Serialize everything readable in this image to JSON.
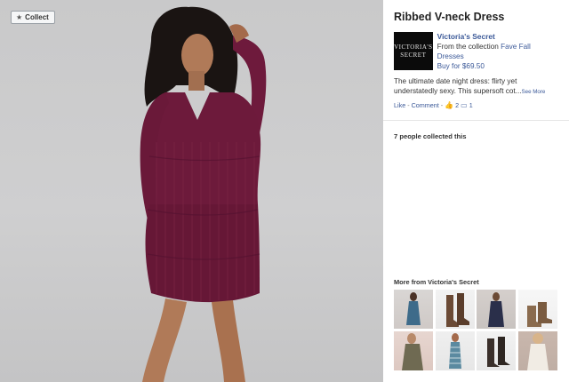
{
  "stage": {
    "collect_label": "Collect",
    "photo_icon": "model-in-dress-photo"
  },
  "panel": {
    "title": "Ribbed V-neck Dress",
    "brand": {
      "logo_lines": [
        "VICTORIA'S",
        "SECRET"
      ],
      "name": "Victoria's Secret",
      "collection_prefix": "From the collection ",
      "collection_name": "Fave Fall Dresses",
      "buy_label": "Buy for $69.50"
    },
    "description": "The ultimate date night dress: flirty yet understatedly sexy. This supersoft cot...",
    "see_more": "See More",
    "actions": {
      "like": "Like",
      "dash": " - ",
      "comment": "Comment",
      "dash2": " - ",
      "like_count": "2",
      "comment_count": "1"
    },
    "collected_text": "7 people collected this",
    "more_title": "More from Victoria's Secret",
    "thumbnails": [
      {
        "label": "blue-dress"
      },
      {
        "label": "brown-boots"
      },
      {
        "label": "navy-dress"
      },
      {
        "label": "tan-boots"
      },
      {
        "label": "floral-dress"
      },
      {
        "label": "striped-dress"
      },
      {
        "label": "black-boots"
      },
      {
        "label": "cream-dress"
      }
    ]
  }
}
